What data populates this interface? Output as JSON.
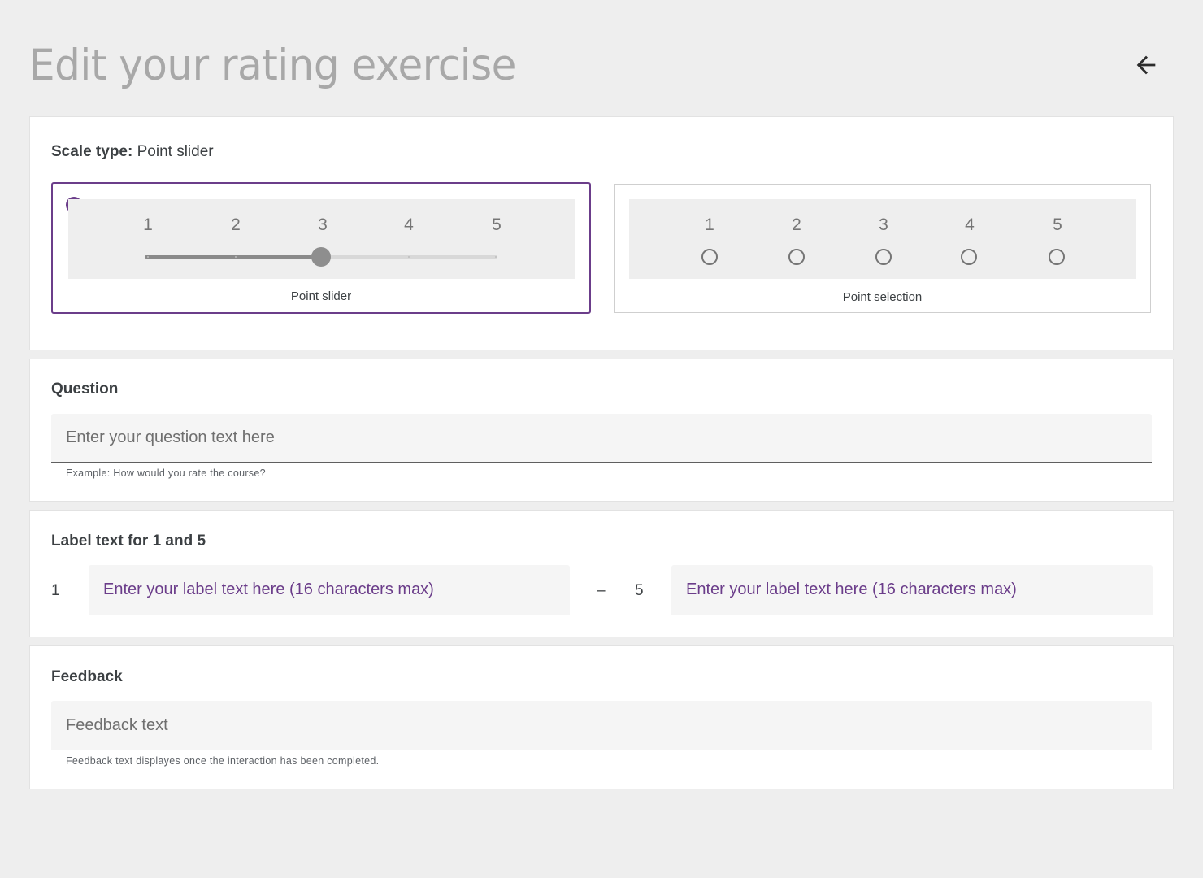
{
  "header": {
    "title": "Edit your rating exercise",
    "back_icon": "arrow-left-icon"
  },
  "scale": {
    "heading_label": "Scale type:",
    "heading_value": "Point slider",
    "options": [
      {
        "label": "Point slider",
        "selected": true,
        "ticks": [
          "1",
          "2",
          "3",
          "4",
          "5"
        ],
        "slider_value": 3
      },
      {
        "label": "Point selection",
        "selected": false,
        "ticks": [
          "1",
          "2",
          "3",
          "4",
          "5"
        ]
      }
    ],
    "accent_color": "#6b3d8a"
  },
  "question": {
    "heading": "Question",
    "placeholder": "Enter your question text here",
    "helper": "Example: How would you rate the course?"
  },
  "labels": {
    "heading": "Label text for 1 and 5",
    "start_number": "1",
    "end_number": "5",
    "separator": "–",
    "start_placeholder": "Enter your label text here (16 characters max)",
    "end_placeholder": "Enter your label text here (16 characters max)"
  },
  "feedback": {
    "heading": "Feedback",
    "placeholder": "Feedback text",
    "helper": "Feedback text displayes once the interaction has been completed."
  }
}
